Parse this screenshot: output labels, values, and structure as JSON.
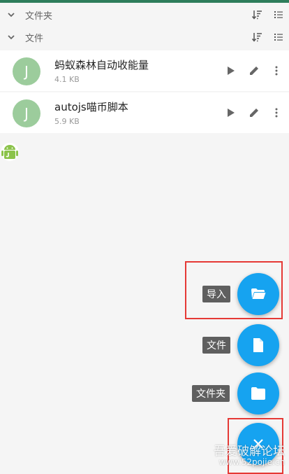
{
  "sections": {
    "folders_label": "文件夹",
    "files_label": "文件"
  },
  "files": [
    {
      "avatar_letter": "J",
      "name": "蚂蚁森林自动收能量",
      "size": "4.1 KB"
    },
    {
      "avatar_letter": "J",
      "name": "autojs喵币脚本",
      "size": "5.9 KB"
    }
  ],
  "fab_menu": {
    "import_label": "导入",
    "file_label": "文件",
    "folder_label": "文件夹",
    "main_icon": "close-icon"
  },
  "watermark": {
    "line1": "吾爱破解论坛",
    "line2": "www.52pojie.cn"
  },
  "colors": {
    "accent": "#16a3f0",
    "avatar": "#9ccc9c",
    "highlight_box": "#e53935"
  }
}
